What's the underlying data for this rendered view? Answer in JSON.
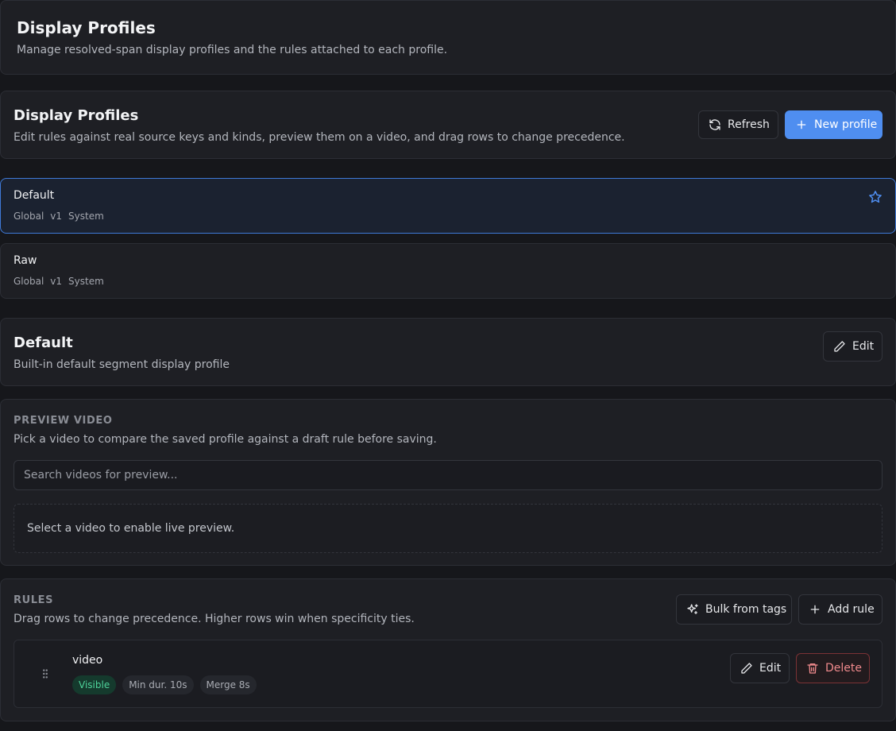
{
  "header": {
    "title": "Display Profiles",
    "subtitle": "Manage resolved-span display profiles and the rules attached to each profile."
  },
  "toolbar": {
    "title": "Display Profiles",
    "subtitle": "Edit rules against real source keys and kinds, preview them on a video, and drag rows to change precedence.",
    "refresh_label": "Refresh",
    "new_profile_label": "New profile"
  },
  "profiles": [
    {
      "name": "Default",
      "scope": "Global",
      "version": "v1",
      "type": "System",
      "selected": true
    },
    {
      "name": "Raw",
      "scope": "Global",
      "version": "v1",
      "type": "System",
      "selected": false
    }
  ],
  "detail": {
    "title": "Default",
    "description": "Built-in default segment display profile",
    "edit_label": "Edit"
  },
  "preview": {
    "heading": "PREVIEW VIDEO",
    "description": "Pick a video to compare the saved profile against a draft rule before saving.",
    "search_placeholder": "Search videos for preview...",
    "search_value": "",
    "empty_message": "Select a video to enable live preview."
  },
  "rules": {
    "heading": "RULES",
    "description": "Drag rows to change precedence. Higher rows win when specificity ties.",
    "bulk_label": "Bulk from tags",
    "add_label": "Add rule",
    "items": [
      {
        "name": "video",
        "visibility": "Visible",
        "min_duration": "Min dur. 10s",
        "merge": "Merge 8s",
        "edit_label": "Edit",
        "delete_label": "Delete"
      }
    ]
  },
  "colors": {
    "accent": "#4f8ef0",
    "visible_badge": "#4ed39a",
    "danger": "#f08a8d"
  }
}
